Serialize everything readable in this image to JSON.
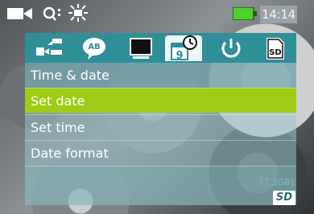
{
  "status_bar": {
    "icons": [
      "video-camera-icon",
      "zoom-question-icon",
      "brightness-sun-icon",
      "battery-icon"
    ],
    "time": "14:14",
    "colors": {
      "battery_fill": "#4fcf2a",
      "time_bg": "#9aa3a8"
    }
  },
  "menu": {
    "tabs": [
      {
        "icon": "usb-connection-icon"
      },
      {
        "icon": "language-icon",
        "glyph": "AB"
      },
      {
        "icon": "display-icon"
      },
      {
        "icon": "calendar-clock-icon",
        "glyph": "9",
        "active": true
      },
      {
        "icon": "power-icon"
      },
      {
        "icon": "sd-card-icon",
        "glyph": "SD"
      }
    ],
    "section_title": "Time & date",
    "items": [
      {
        "label": "Set date",
        "selected": true
      },
      {
        "label": "Set time",
        "selected": false
      },
      {
        "label": "Date format",
        "selected": false
      }
    ],
    "colors": {
      "tab_bar": "#2f8f98",
      "selected": "#9fcc17"
    }
  },
  "storage": {
    "memory": "[7.3GB]",
    "media_badge": "SD"
  }
}
